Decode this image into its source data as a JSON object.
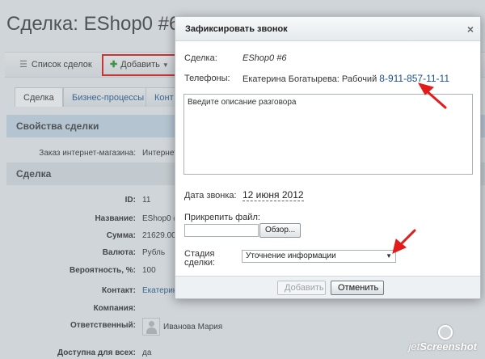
{
  "page": {
    "title": "Сделка: EShop0 #6",
    "toolbar": {
      "list_label": "Список сделок",
      "add_label": "Добавить"
    },
    "tabs": [
      "Сделка",
      "Бизнес-процессы",
      "Конт"
    ],
    "sections": {
      "props": "Свойства сделки",
      "deal": "Сделка"
    },
    "fields": [
      {
        "label": "Заказ интернет-магазина:",
        "value": "Интернет"
      },
      {
        "label": "ID:",
        "value": "11"
      },
      {
        "label": "Название:",
        "value": "EShop0 #"
      },
      {
        "label": "Сумма:",
        "value": "21629.00"
      },
      {
        "label": "Валюта:",
        "value": "Рубль"
      },
      {
        "label": "Вероятность, %:",
        "value": "100"
      },
      {
        "label": "Контакт:",
        "value": "Екатерин"
      },
      {
        "label": "Компания:",
        "value": ""
      },
      {
        "label": "Ответственный:",
        "value": "Иванова Мария"
      },
      {
        "label": "Доступна для всех:",
        "value": "да"
      }
    ]
  },
  "dialog": {
    "title": "Зафиксировать звонок",
    "close_glyph": "×",
    "deal_label": "Сделка:",
    "deal_value": "EShop0 #6",
    "phones_label": "Телефоны:",
    "phone_owner": "Екатерина Богатырева: Рабочий",
    "phone_number": "8-911-857-11-11",
    "description_placeholder": "Введите описание разговора",
    "date_label": "Дата звонка:",
    "date_value": "12 июня 2012",
    "attach_label": "Прикрепить файл:",
    "browse_label": "Обзор...",
    "stage_label_1": "Стадия",
    "stage_label_2": "сделки:",
    "stage_value": "Уточнение информации",
    "btn_add": "Добавить",
    "btn_cancel": "Отменить"
  },
  "watermark": {
    "prefix": "jet",
    "suffix": "Screenshot"
  },
  "colors": {
    "highlight_red": "#e21b1b",
    "link_blue": "#1d4f8a",
    "section_blue": "#c9dbe8"
  }
}
